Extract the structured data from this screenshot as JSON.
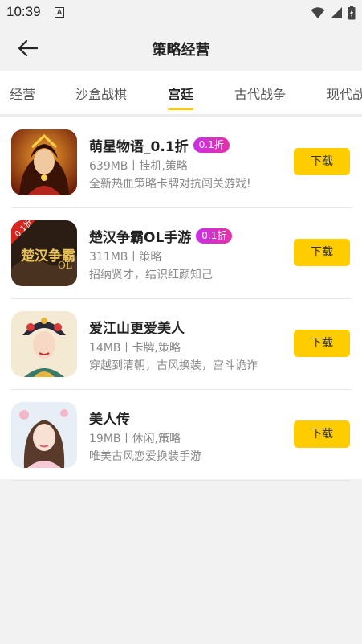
{
  "status_bar": {
    "time": "10:39",
    "notification_icon": "A",
    "icons": [
      "wifi-icon",
      "signal-icon",
      "battery-icon"
    ]
  },
  "header": {
    "title": "策略经营",
    "back_icon": "arrow-left-icon"
  },
  "tabs": {
    "items": [
      {
        "label": "经营"
      },
      {
        "label": "沙盒战棋"
      },
      {
        "label": "宫廷",
        "active": true
      },
      {
        "label": "古代战争"
      },
      {
        "label": "现代战"
      }
    ],
    "active_color": "#ffcc00"
  },
  "games": [
    {
      "name": "萌星物语_0.1折",
      "badge": "0.1折",
      "meta": "639MB丨挂机,策略",
      "desc": "全新热血策略卡牌对抗闯关游戏!",
      "button": "下载"
    },
    {
      "name": "楚汉争霸OL手游",
      "badge": "0.1折",
      "meta": "311MB丨策略",
      "desc": "招纳贤才，结识红颜知己",
      "button": "下载",
      "icon_text": "0.1折"
    },
    {
      "name": "爱江山更爱美人",
      "badge": "",
      "meta": "14MB丨卡牌,策略",
      "desc": "穿越到清朝，古风换装，宫斗诡诈",
      "button": "下载"
    },
    {
      "name": "美人传",
      "badge": "",
      "meta": "19MB丨休闲,策略",
      "desc": "唯美古风恋爱换装手游",
      "button": "下载"
    }
  ],
  "colors": {
    "accent": "#ffcc00",
    "badge_gradient": [
      "#c930e6",
      "#e232a6"
    ],
    "background": "#f2f2f2"
  }
}
